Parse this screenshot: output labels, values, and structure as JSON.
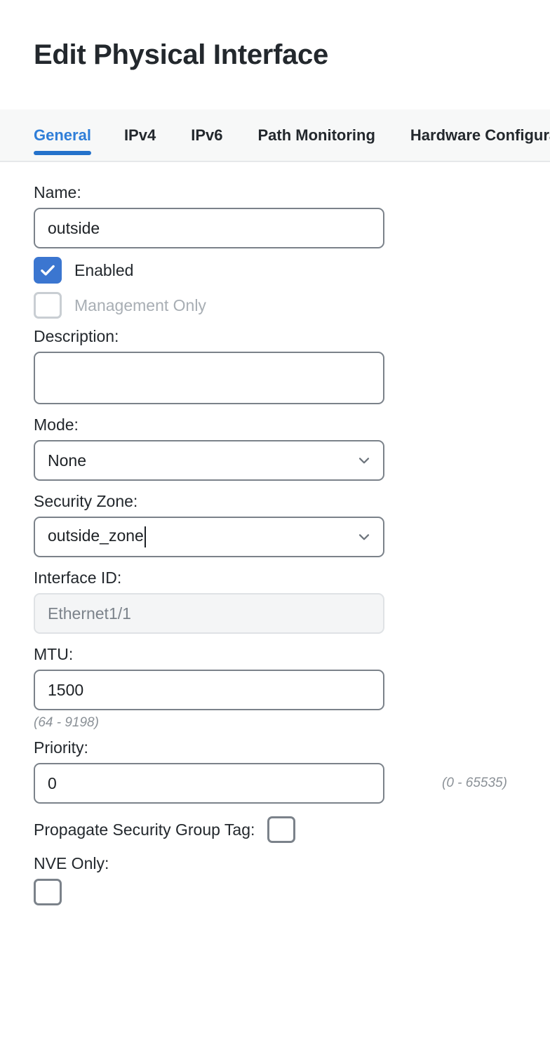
{
  "dialog": {
    "title": "Edit Physical Interface"
  },
  "tabs": [
    {
      "label": "General",
      "active": true
    },
    {
      "label": "IPv4",
      "active": false
    },
    {
      "label": "IPv6",
      "active": false
    },
    {
      "label": "Path Monitoring",
      "active": false
    },
    {
      "label": "Hardware Configuration",
      "active": false
    }
  ],
  "form": {
    "name": {
      "label": "Name:",
      "value": "outside"
    },
    "enabled": {
      "label": "Enabled",
      "checked": true
    },
    "management_only": {
      "label": "Management Only",
      "checked": false,
      "disabled": true
    },
    "description": {
      "label": "Description:",
      "value": ""
    },
    "mode": {
      "label": "Mode:",
      "value": "None"
    },
    "security_zone": {
      "label": "Security Zone:",
      "value": "outside_zone",
      "focused": true
    },
    "interface_id": {
      "label": "Interface ID:",
      "value": "Ethernet1/1",
      "disabled": true
    },
    "mtu": {
      "label": "MTU:",
      "value": "1500",
      "hint": "(64 - 9198)"
    },
    "priority": {
      "label": "Priority:",
      "value": "0",
      "hint": "(0 - 65535)"
    },
    "propagate_sgt": {
      "label": "Propagate Security Group Tag:",
      "checked": false
    },
    "nve_only": {
      "label": "NVE Only:",
      "checked": false
    }
  },
  "colors": {
    "accent": "#2472cb",
    "accent_text": "#2f7ed8",
    "checkbox_checked": "#3b76d0",
    "border": "#7b828a",
    "text": "#23282d",
    "hint": "#8b9197",
    "disabled_bg": "#f4f5f6",
    "tabbar_bg": "#f7f8f8"
  },
  "icons": {
    "chevron_down": "chevron-down-icon",
    "check": "check-icon"
  }
}
